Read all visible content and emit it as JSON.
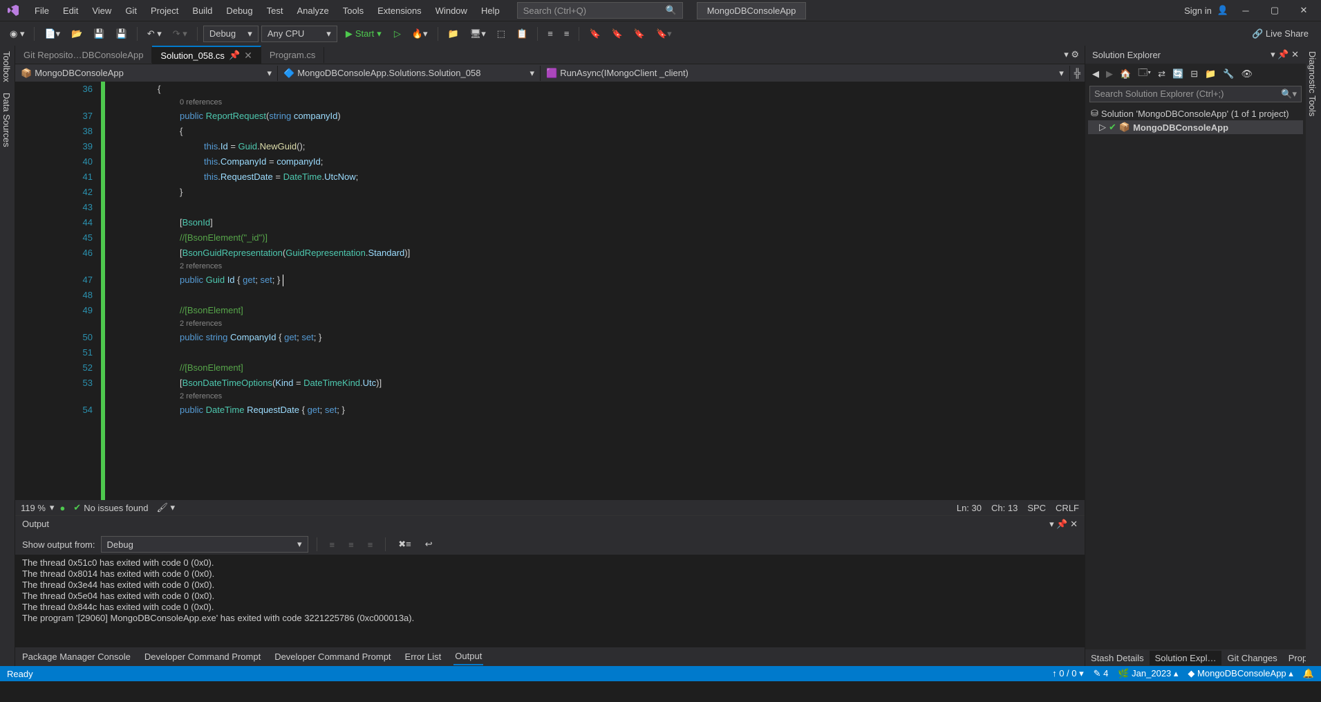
{
  "titlebar": {
    "menu": [
      "File",
      "Edit",
      "View",
      "Git",
      "Project",
      "Build",
      "Debug",
      "Test",
      "Analyze",
      "Tools",
      "Extensions",
      "Window",
      "Help"
    ],
    "search_placeholder": "Search (Ctrl+Q)",
    "app_name": "MongoDBConsoleApp",
    "sign_in": "Sign in"
  },
  "toolbar": {
    "config": "Debug",
    "platform": "Any CPU",
    "start": "Start",
    "live_share": "Live Share"
  },
  "tabs": {
    "items": [
      {
        "label": "Git Reposito…DBConsoleApp",
        "active": false
      },
      {
        "label": "Solution_058.cs",
        "active": true,
        "pinned": true
      },
      {
        "label": "Program.cs",
        "active": false
      }
    ]
  },
  "nav": {
    "project": "MongoDBConsoleApp",
    "class": "MongoDBConsoleApp.Solutions.Solution_058",
    "method": "RunAsync(IMongoClient _client)"
  },
  "editor": {
    "zoom": "119 %",
    "issues": "No issues found",
    "pos_ln": "Ln: 30",
    "pos_ch": "Ch: 13",
    "indent": "SPC",
    "eol": "CRLF",
    "ref0": "0 references",
    "ref2a": "2 references",
    "ref2b": "2 references",
    "ref2c": "2 references",
    "lines": {
      "36": "{",
      "37": [
        "public",
        " ",
        "ReportRequest",
        "(",
        "string",
        " ",
        "companyId",
        ")"
      ],
      "38": "{",
      "39": [
        "this",
        ".",
        "Id",
        " = ",
        "Guid",
        ".",
        "NewGuid",
        "();"
      ],
      "40": [
        "this",
        ".",
        "CompanyId",
        " = ",
        "companyId",
        ";"
      ],
      "41": [
        "this",
        ".",
        "RequestDate",
        " = ",
        "DateTime",
        ".",
        "UtcNow",
        ";"
      ],
      "42": "}",
      "43": "",
      "44": [
        "[",
        "BsonId",
        "]"
      ],
      "45": "//[BsonElement(\"_id\")]",
      "46": [
        "[",
        "BsonGuidRepresentation",
        "(",
        "GuidRepresentation",
        ".",
        "Standard",
        ")]"
      ],
      "47": [
        "public",
        " ",
        "Guid",
        " ",
        "Id",
        " { ",
        "get",
        "; ",
        "set",
        "; }"
      ],
      "48": "",
      "49": "//[BsonElement]",
      "50": [
        "public",
        " ",
        "string",
        " ",
        "CompanyId",
        " { ",
        "get",
        "; ",
        "set",
        "; }"
      ],
      "51": "",
      "52": "//[BsonElement]",
      "53": [
        "[",
        "BsonDateTimeOptions",
        "(",
        "Kind",
        " = ",
        "DateTimeKind",
        ".",
        "Utc",
        ")]"
      ],
      "54": [
        "public",
        " ",
        "DateTime",
        " ",
        "RequestDate",
        " { ",
        "get",
        "; ",
        "set",
        "; }"
      ]
    }
  },
  "side_tabs": [
    "Stash Details",
    "Solution Expl…",
    "Git Changes",
    "Properties"
  ],
  "output": {
    "title": "Output",
    "from_label": "Show output from:",
    "from_value": "Debug",
    "lines": [
      "The thread 0x51c0 has exited with code 0 (0x0).",
      "The thread 0x8014 has exited with code 0 (0x0).",
      "The thread 0x3e44 has exited with code 0 (0x0).",
      "The thread 0x5e04 has exited with code 0 (0x0).",
      "The thread 0x844c has exited with code 0 (0x0).",
      "The program '[29060] MongoDBConsoleApp.exe' has exited with code 3221225786 (0xc000013a)."
    ]
  },
  "bottom_tabs": [
    "Package Manager Console",
    "Developer Command Prompt",
    "Developer Command Prompt",
    "Error List",
    "Output"
  ],
  "solution_explorer": {
    "title": "Solution Explorer",
    "search_placeholder": "Search Solution Explorer (Ctrl+;)",
    "root": "Solution 'MongoDBConsoleApp' (1 of 1 project)",
    "project": "MongoDBConsoleApp"
  },
  "statusbar": {
    "ready": "Ready",
    "updown": "↑ 0 / 0 ▾",
    "pencil": "✎ 4",
    "branch": "Jan_2023 ▴",
    "repo": "MongoDBConsoleApp ▴"
  },
  "left_rail": [
    "Toolbox",
    "Data Sources"
  ],
  "right_rail": "Diagnostic Tools"
}
